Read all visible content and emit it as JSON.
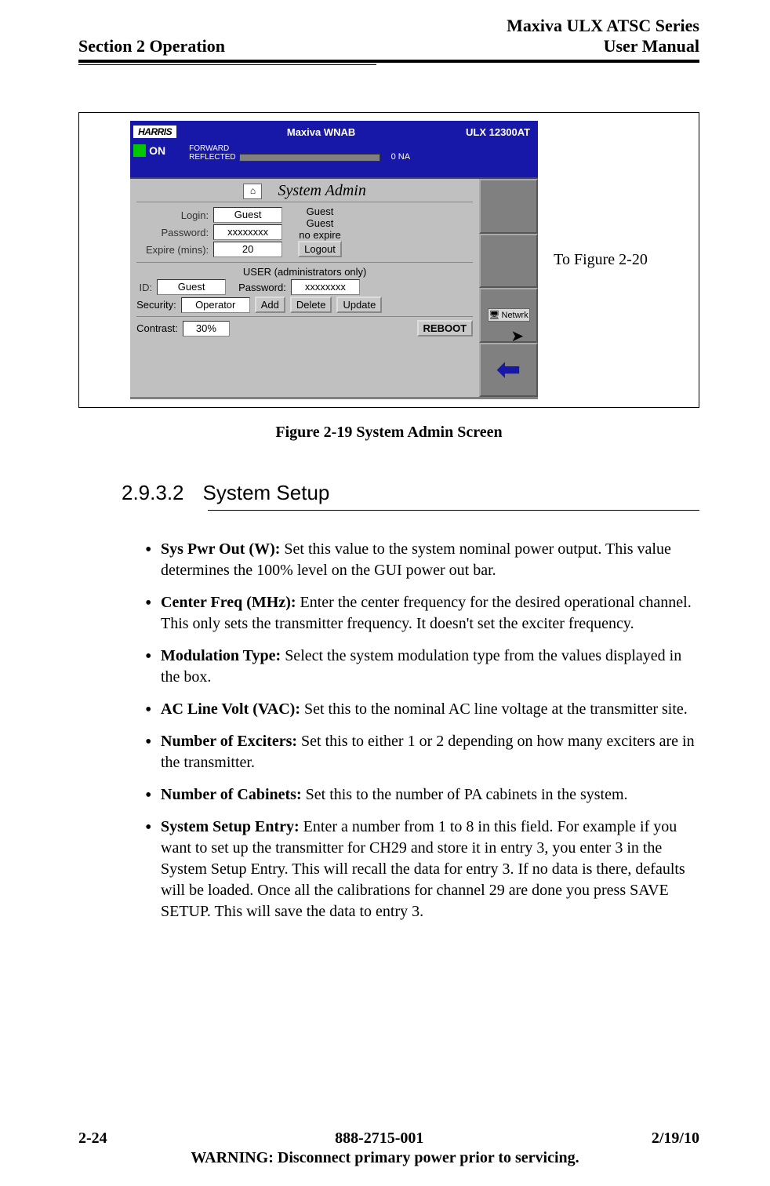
{
  "header": {
    "section": "Section 2 Operation",
    "series": "Maxiva ULX ATSC Series",
    "manual": "User Manual"
  },
  "figure": {
    "caption": "Figure 2-19  System Admin Screen",
    "to_label": "To Figure 2-20"
  },
  "screenshot": {
    "logo": "HARRIS",
    "title_mid": "Maxiva WNAB",
    "title_right": "ULX 12300AT",
    "on": "ON",
    "forward": "FORWARD",
    "reflected": "REFLECTED",
    "ona": "0 NA",
    "panel_title": "System Admin",
    "login_label": "Login:",
    "login_value": "Guest",
    "pw_label": "Password:",
    "pw_value": "xxxxxxxx",
    "expire_label": "Expire (mins):",
    "expire_value": "20",
    "guest1": "Guest",
    "guest2": "Guest",
    "noexpire": "no expire",
    "logout": "Logout",
    "user_hdr": "USER (administrators only)",
    "id_label": "ID:",
    "id_value": "Guest",
    "pw2_label": "Password:",
    "pw2_value": "xxxxxxxx",
    "sec_label": "Security:",
    "sec_value": "Operator",
    "add": "Add",
    "delete": "Delete",
    "update": "Update",
    "contrast_label": "Contrast:",
    "contrast_value": "30%",
    "reboot": "REBOOT",
    "netwrk": "Netwrk"
  },
  "subsection": {
    "number": "2.9.3.2",
    "title": "System Setup"
  },
  "bullets": [
    {
      "bold": "Sys Pwr Out (W):",
      "text": " Set this value to the system nominal power output. This value determines the 100% level on the GUI power out bar."
    },
    {
      "bold": "Center Freq (MHz):",
      "text": " Enter the center frequency for the desired operational channel. This only sets the transmitter frequency. It doesn't set the exciter frequency."
    },
    {
      "bold": " Modulation Type:",
      "text": " Select the system modulation type from the values displayed in the box."
    },
    {
      "bold": "AC Line Volt (VAC):",
      "text": " Set this to the nominal AC line voltage at the transmitter site."
    },
    {
      "bold": "Number of Exciters:",
      "text": " Set this to either 1 or 2 depending on how many exciters are in the transmitter."
    },
    {
      "bold": "Number of Cabinets:",
      "text": " Set this to the number of PA cabinets in the system."
    },
    {
      "bold": "System Setup Entry:",
      "text": " Enter a number from 1 to 8 in this field. For example if you want to set up the transmitter for CH29 and store it in entry 3, you enter 3 in the System Setup Entry. This will recall the data for entry 3. If no data is there, defaults will be loaded. Once all the calibrations for channel 29 are done you press SAVE SETUP. This will save the data to entry 3."
    }
  ],
  "footer": {
    "page": "2-24",
    "phone": "888-2715-001",
    "date": "2/19/10",
    "warning": "WARNING: Disconnect primary power prior to servicing."
  }
}
